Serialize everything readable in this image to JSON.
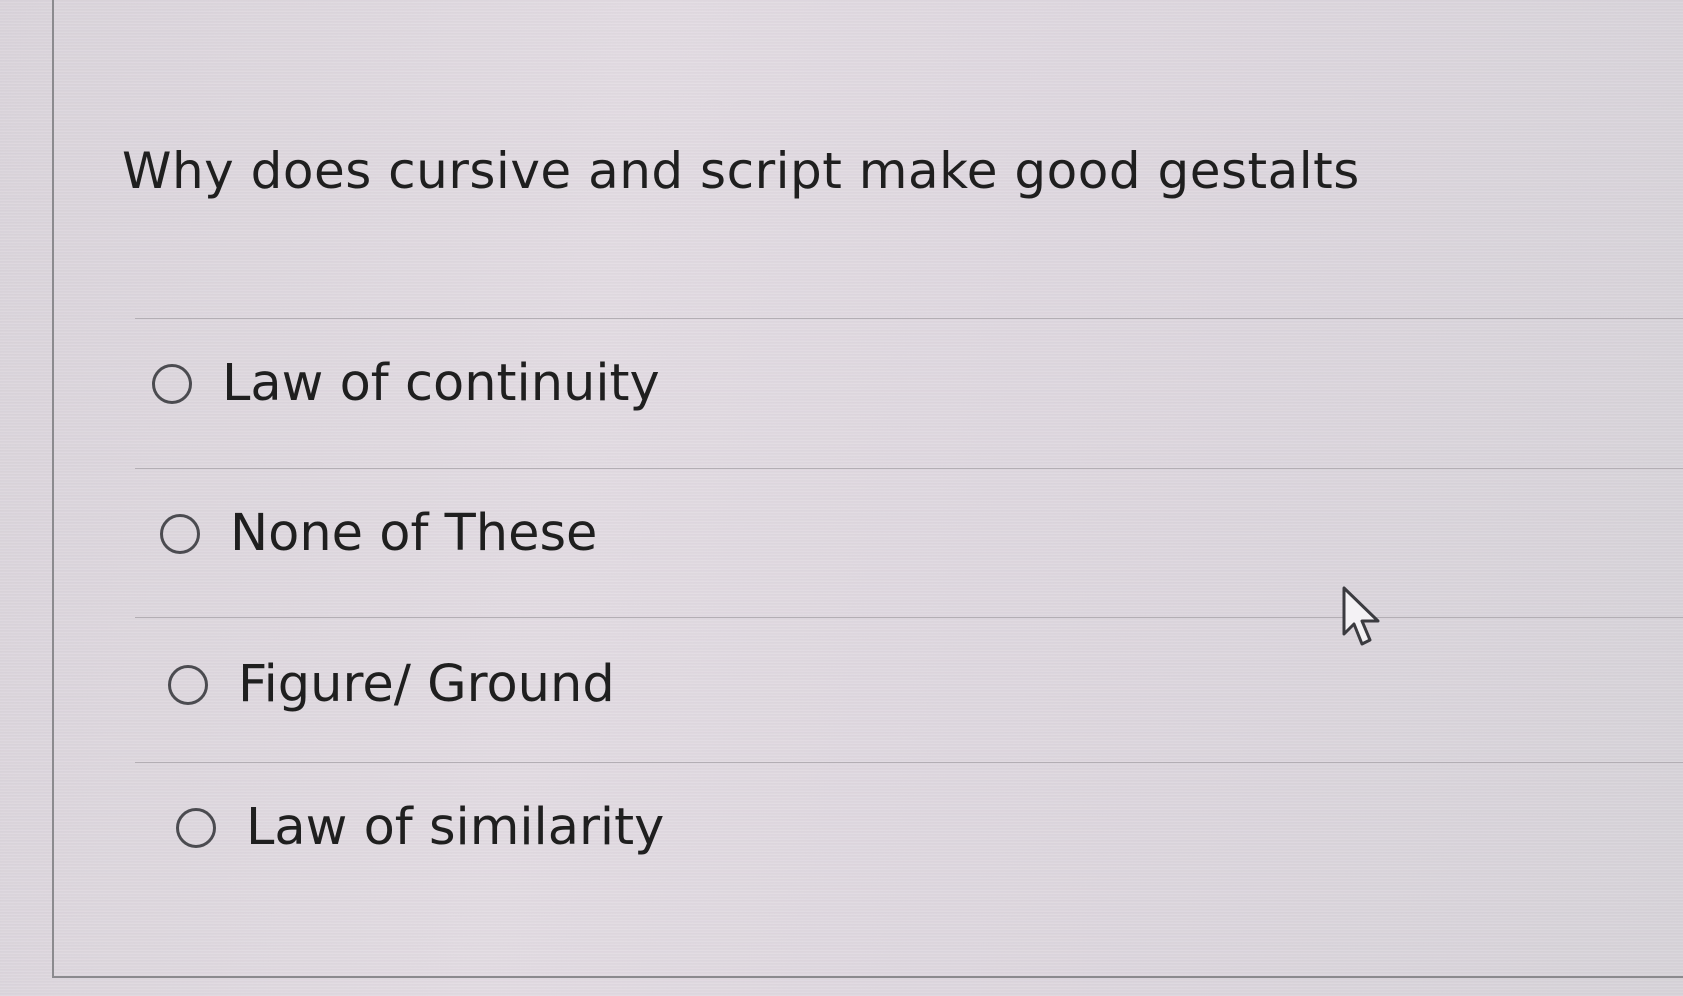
{
  "question": {
    "text": "Why does cursive and script make good gestalts"
  },
  "options": [
    {
      "label": "Law of continuity",
      "selected": false
    },
    {
      "label": "None of These",
      "selected": false
    },
    {
      "label": "Figure/ Ground",
      "selected": false
    },
    {
      "label": "Law of similarity",
      "selected": false
    }
  ],
  "colors": {
    "background": "#dcd6dc",
    "text": "#1f1f1f",
    "radio_border": "#4b4b50",
    "divider": "#b3aeb4"
  },
  "icons": {
    "radio": "radio-unselected-icon",
    "cursor": "mouse-pointer-icon"
  }
}
